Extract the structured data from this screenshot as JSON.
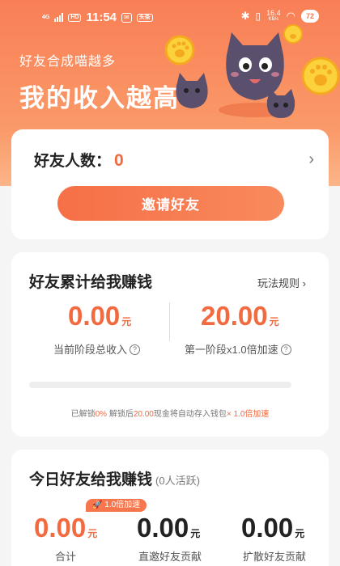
{
  "status_bar": {
    "network": "4G",
    "hd": "HD",
    "time": "11:54",
    "app_chip": "头条",
    "speed_value": "16.4",
    "speed_unit": "KB/s",
    "battery": "72"
  },
  "hero": {
    "subtitle": "好友合成喵越多",
    "title": "我的收入越高",
    "art_icons": [
      "paw-coin-icon",
      "cat-mascot-icon"
    ]
  },
  "friends_card": {
    "label": "好友人数：",
    "value": "0",
    "invite_button": "邀请好友"
  },
  "cumulative_card": {
    "title": "好友累计给我赚钱",
    "rules_link": "玩法规则",
    "current_income": {
      "value": "0.00",
      "unit": "元",
      "label": "当前阶段总收入"
    },
    "stage_accel": {
      "value": "20.00",
      "unit": "元",
      "label": "第一阶段x1.0倍加速"
    },
    "progress": 0,
    "note": {
      "p1": "已解锁",
      "p2": "0%",
      "p3": " 解锁后",
      "p4": "20.00",
      "p5": "现金将自动存入钱包",
      "p6": "× 1.0倍加速"
    }
  },
  "today_card": {
    "title": "今日好友给我赚钱",
    "active": "(0人活跃)",
    "badge": "🚀 1.0倍加速",
    "total": {
      "value": "0.00",
      "unit": "元",
      "label": "合计"
    },
    "direct": {
      "value": "0.00",
      "unit": "元",
      "label": "直邀好友贡献"
    },
    "spread": {
      "value": "0.00",
      "unit": "元",
      "label": "扩散好友贡献"
    }
  },
  "colors": {
    "accent": "#f26a3f",
    "hero_top": "#f97f56",
    "button": "#f66f47",
    "background": "#f5f5f5"
  }
}
